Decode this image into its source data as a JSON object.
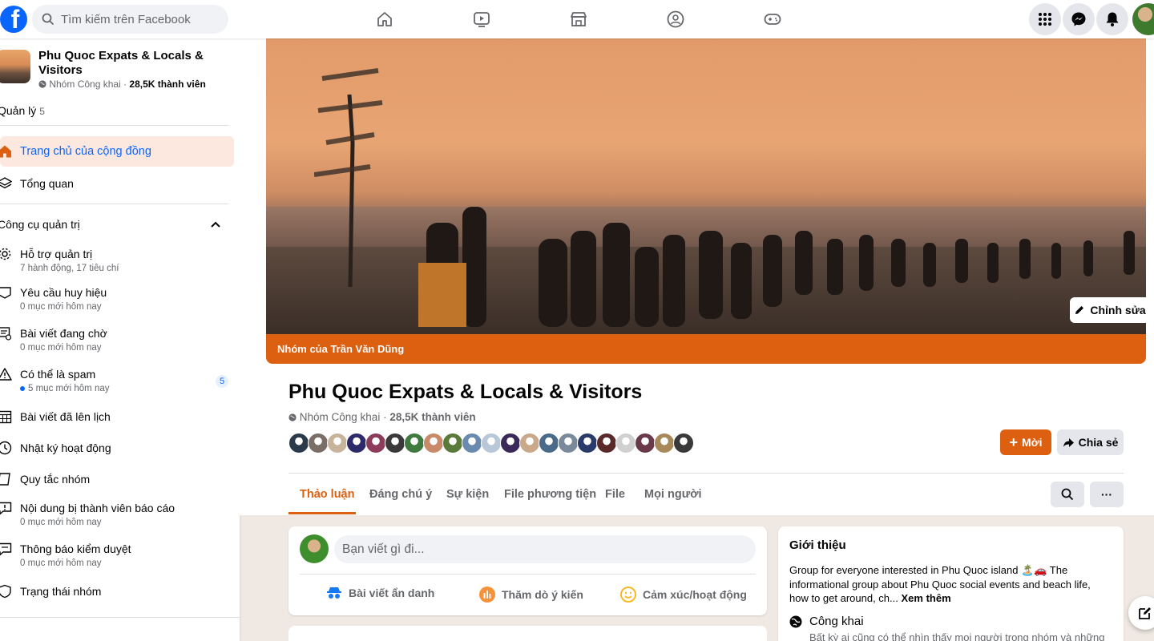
{
  "topbar": {
    "logo": "f",
    "search_placeholder": "Tìm kiếm trên Facebook",
    "nav_icons": [
      "home-icon",
      "video-icon",
      "marketplace-icon",
      "groups-icon",
      "gaming-icon"
    ],
    "right_icons": [
      "menu-grid-icon",
      "messenger-icon",
      "bell-icon",
      "profile-avatar"
    ]
  },
  "sidebar": {
    "group_name": "Phu Quoc Expats & Locals & Visitors",
    "group_privacy": "Nhóm Công khai",
    "group_members": "28,5K thành viên",
    "manage_label": "Quản lý",
    "manage_count": "5",
    "home_item": "Trang chủ của cộng đồng",
    "overview_item": "Tổng quan",
    "tools_header": "Công cụ quản trị",
    "items": [
      {
        "label": "Hỗ trợ quản trị",
        "sub": "7 hành động, 17 tiêu chí"
      },
      {
        "label": "Yêu cầu huy hiệu",
        "sub": "0 mục mới hôm nay"
      },
      {
        "label": "Bài viết đang chờ",
        "sub": "0 mục mới hôm nay"
      },
      {
        "label": "Có thể là spam",
        "sub": "5 mục mới hôm nay",
        "badge": "5"
      },
      {
        "label": "Bài viết đã lên lịch",
        "sub": ""
      },
      {
        "label": "Nhật ký hoạt động",
        "sub": ""
      },
      {
        "label": "Quy tắc nhóm",
        "sub": ""
      },
      {
        "label": "Nội dung bị thành viên báo cáo",
        "sub": "0 mục mới hôm nay"
      },
      {
        "label": "Thông báo kiểm duyệt",
        "sub": "0 mục mới hôm nay"
      },
      {
        "label": "Trạng thái nhóm",
        "sub": ""
      }
    ]
  },
  "cover": {
    "owner_bar": "Nhóm của Trần Văn Dũng",
    "edit_label": "Chỉnh sửa"
  },
  "group": {
    "title": "Phu Quoc Expats & Locals & Visitors",
    "privacy": "Nhóm Công khai",
    "members": "28,5K thành viên",
    "new_label": "Mời",
    "share_label": "Chia sẻ",
    "tabs": [
      "Thảo luận",
      "Đáng chú ý",
      "Sự kiện",
      "File phương tiện",
      "File",
      "Mọi người"
    ],
    "more_label": "···"
  },
  "colors": {
    "accent": "#dd5f10",
    "facebook_blue": "#0866ff",
    "member_avatars": [
      "#2b3a4a",
      "#7a6e66",
      "#c7b49a",
      "#2d2a6b",
      "#8c3b5a",
      "#3a3a3a",
      "#3f7a3f",
      "#c98a6a",
      "#5a7a3a",
      "#6a8ab0",
      "#b8c8d8",
      "#3a2a5a",
      "#c9a98a",
      "#4a6a8a",
      "#7a8a9a",
      "#2a3a6a",
      "#5a2a2a",
      "#d0d0d0",
      "#6a3a4a",
      "#a88a5a",
      "#3a3a3a"
    ]
  },
  "composer": {
    "placeholder": "Bạn viết gì đi...",
    "anon": "Bài viết ẩn danh",
    "poll": "Thăm dò ý kiến",
    "feeling": "Cảm xúc/hoạt động"
  },
  "about": {
    "heading": "Giới thiệu",
    "text": "Group for everyone interested in Phu Quoc island 🏝️🚗 The informational group about Phu Quoc social events and beach life, how to get around, ch...",
    "see_more": "Xem thêm",
    "public_label": "Công khai",
    "public_sub": "Bất kỳ ai cũng có thể nhìn thấy mọi người trong nhóm và những"
  }
}
